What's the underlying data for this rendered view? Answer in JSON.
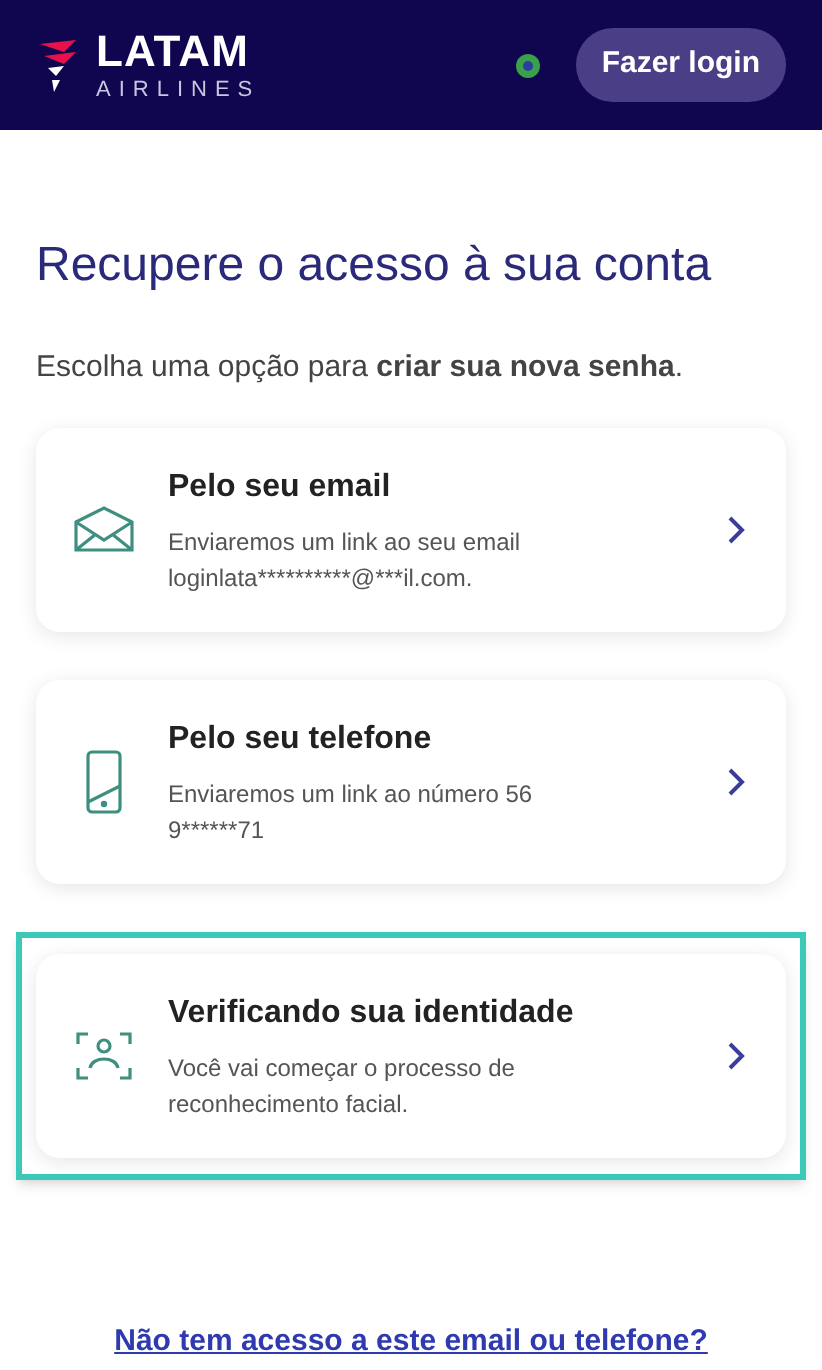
{
  "header": {
    "logo": {
      "name": "LATAM",
      "tagline": "AIRLINES"
    },
    "login_button": "Fazer login"
  },
  "title": "Recupere o acesso à sua conta",
  "subtitle": "Escolha uma opção para **criar sua nova senha**.",
  "options": [
    {
      "kind": "email",
      "title": "Pelo seu email",
      "description": "Enviaremos um link ao seu email loginlata**********@***il.com.",
      "selected": false
    },
    {
      "kind": "phone",
      "title": "Pelo seu telefone",
      "description": "Enviaremos um link ao número 56 9******71",
      "selected": false
    },
    {
      "kind": "face",
      "title": "Verificando sua identidade",
      "description": "Você vai começar o processo de reconhecimento facial.",
      "selected": true
    }
  ],
  "help_link": "Não tem acesso a este email ou telefone?"
}
